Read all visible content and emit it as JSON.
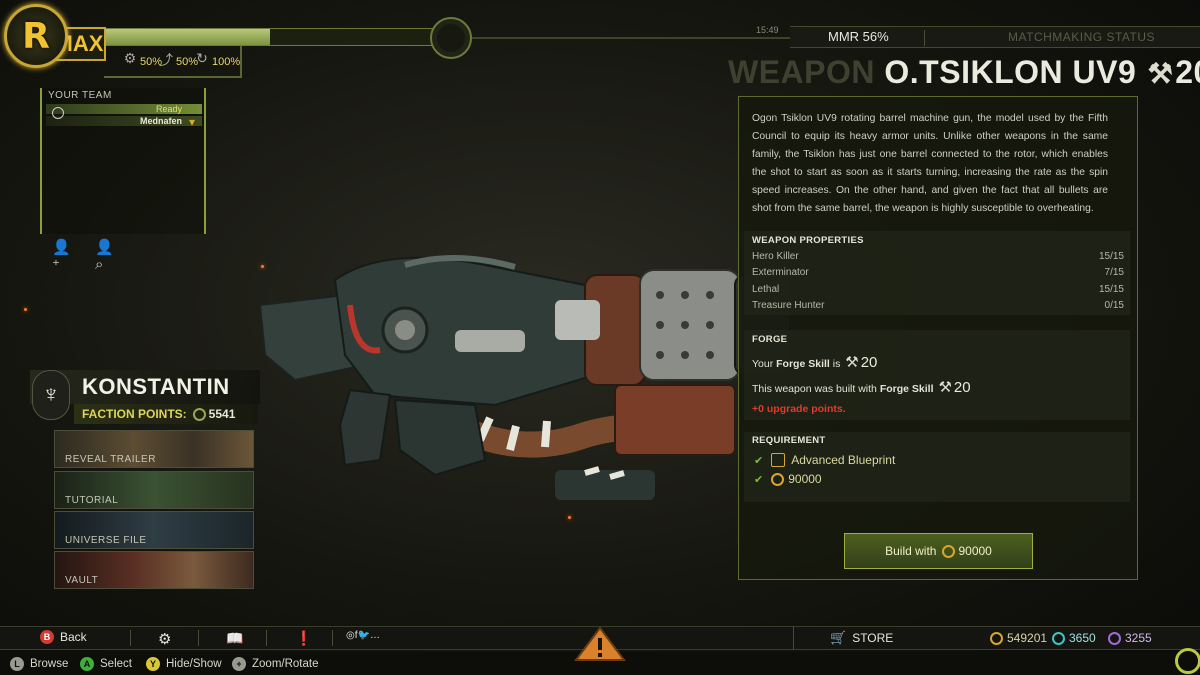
{
  "profile": {
    "emblem_letter": "R",
    "player_name": "MAX",
    "xp_fraction": 0.5,
    "bonuses": [
      {
        "icon": "xp-boost-icon",
        "value": "50%"
      },
      {
        "icon": "reward-boost-icon",
        "value": "50%"
      },
      {
        "icon": "speed-boost-icon",
        "value": "100%"
      }
    ]
  },
  "team": {
    "title": "YOUR TEAM",
    "members": [
      {
        "status": "Ready",
        "name": "Mednafen"
      }
    ]
  },
  "faction": {
    "name": "KONSTANTIN",
    "points_label": "FACTION POINTS:",
    "points_value": "5541"
  },
  "media": [
    "REVEAL TRAILER",
    "TUTORIAL",
    "UNIVERSE FILE",
    "VAULT"
  ],
  "status": {
    "clock": "15:49",
    "mmr": "MMR 56%",
    "matchmaking": "MATCHMAKING STATUS"
  },
  "weapon": {
    "kind": "WEAPON",
    "name": "O.TSIKLON UV9",
    "forge_level": "20",
    "description": "Ogon Tsiklon UV9 rotating barrel machine gun, the model used by the Fifth Council to equip its heavy armor units. Unlike other weapons in the same family, the Tsiklon has just one barrel connected to the rotor, which enables the shot to start as soon as it starts turning, increasing the rate as the spin speed increases. On the other hand, and given the fact that all bullets are shot from the same barrel, the weapon is highly susceptible to overheating.",
    "properties_title": "WEAPON PROPERTIES",
    "properties": [
      {
        "name": "Hero Killer",
        "value": "15/15"
      },
      {
        "name": "Exterminator",
        "value": "7/15"
      },
      {
        "name": "Lethal",
        "value": "15/15"
      },
      {
        "name": "Treasure Hunter",
        "value": "0/15"
      }
    ],
    "forge": {
      "title": "FORGE",
      "your_prefix": "Your",
      "forge_skill_label": "Forge Skill",
      "is_word": "is",
      "your_skill": "20",
      "built_prefix": "This weapon was built with",
      "built_skill": "20",
      "upgrade_points": "+0 upgrade points."
    },
    "requirement": {
      "title": "REQUIREMENT",
      "items": [
        {
          "icon": "blueprint-icon",
          "label": "Advanced Blueprint"
        },
        {
          "icon": "credits-icon",
          "label": "90000"
        }
      ]
    },
    "build_button": {
      "prefix": "Build with",
      "amount": "90000"
    }
  },
  "bottom_bar": {
    "back": "Back",
    "store": "STORE",
    "currencies": [
      {
        "icon": "credits-icon",
        "value": "549201",
        "color": "#d8a52e"
      },
      {
        "icon": "premium-icon",
        "value": "3650",
        "color": "#3ec4c7"
      },
      {
        "icon": "special-icon",
        "value": "3255",
        "color": "#a46bd8"
      }
    ],
    "help": [
      {
        "glyph": "L",
        "label": "Browse",
        "color": "#9a9a90"
      },
      {
        "glyph": "A",
        "label": "Select",
        "color": "#3fae3a"
      },
      {
        "glyph": "Y",
        "label": "Hide/Show",
        "color": "#d9c73a"
      },
      {
        "glyph": "+",
        "label": "Zoom/Rotate",
        "color": "#9a9a90"
      }
    ],
    "social_glyphs": "◎f🐦…"
  }
}
